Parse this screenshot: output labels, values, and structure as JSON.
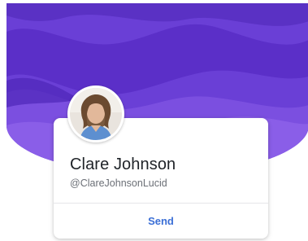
{
  "profile": {
    "name": "Clare Johnson",
    "handle": "@ClareJohnsonLucid"
  },
  "actions": {
    "send_label": "Send"
  },
  "colors": {
    "banner_base": "#6a3fd6",
    "banner_dark": "#4f26b8",
    "banner_light": "#8a5ee8",
    "send_accent": "#3b6fd6"
  }
}
